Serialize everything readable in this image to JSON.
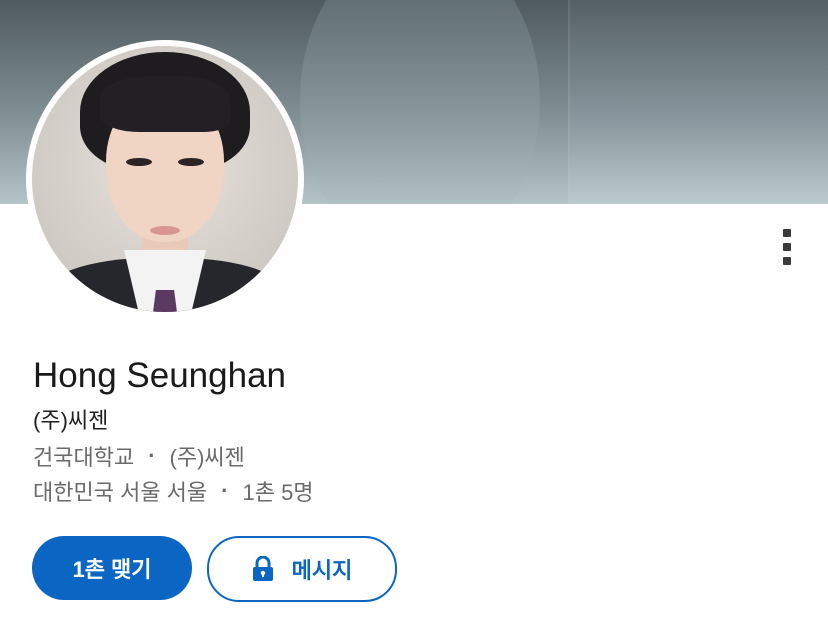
{
  "profile": {
    "name": "Hong Seunghan",
    "headline": "(주)씨젠",
    "education": "건국대학교",
    "company": "(주)씨젠",
    "separator": "·",
    "location": "대한민국 서울 서울",
    "connections": "1촌 5명"
  },
  "actions": {
    "connect_label": "1촌 맺기",
    "message_label": "메시지",
    "message_icon": "lock-icon",
    "more_icon": "more-vertical-icon"
  },
  "colors": {
    "accent": "#0a66c2",
    "name_text": "#1a1a1a",
    "secondary_text": "#6a6a6a"
  }
}
